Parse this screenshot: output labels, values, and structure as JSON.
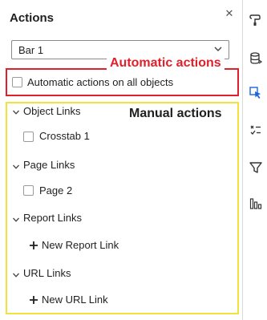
{
  "panel": {
    "title": "Actions",
    "close_glyph": "✕"
  },
  "source_select": {
    "value": "Bar 1"
  },
  "callouts": {
    "automatic": "Automatic actions",
    "manual": "Manual actions"
  },
  "automatic": {
    "checkbox_label": "Automatic actions on all objects",
    "checked": false
  },
  "sections": [
    {
      "title": "Object Links",
      "expanded": true
    },
    {
      "title": "Page Links",
      "expanded": true
    },
    {
      "title": "Report Links",
      "expanded": true
    },
    {
      "title": "URL Links",
      "expanded": true
    }
  ],
  "object_links": [
    {
      "label": "Crosstab 1",
      "checked": false
    }
  ],
  "page_links": [
    {
      "label": "Page 2",
      "checked": false
    }
  ],
  "report_links": {
    "add_label": "New Report Link"
  },
  "url_links": {
    "add_label": "New URL Link"
  },
  "rail": {
    "icons": [
      "paint-roller-icon",
      "data-icon",
      "actions-pointer-icon",
      "rules-icon",
      "filter-icon",
      "ranks-icon"
    ],
    "active": "actions-pointer-icon",
    "accent_color": "#1f64d8"
  },
  "colors": {
    "automatic_highlight": "#e0202a",
    "manual_highlight": "#f3e23a"
  }
}
